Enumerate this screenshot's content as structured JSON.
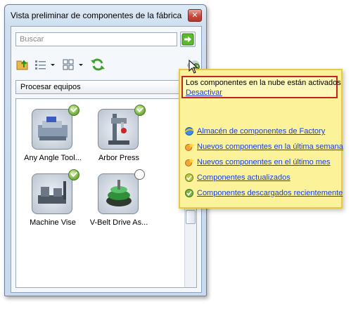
{
  "window": {
    "title": "Vista preliminar de componentes de la fábrica",
    "close_glyph": "✕"
  },
  "search": {
    "placeholder": "Buscar",
    "go_icon": "green-arrow-icon"
  },
  "toolbar": {
    "icons": [
      "folder-upload-icon",
      "list-view-icon",
      "columns-view-icon",
      "refresh-icon",
      "cloud-icon"
    ]
  },
  "dropdown": {
    "selected": "Procesar equipos",
    "caret": "▼"
  },
  "components": [
    {
      "label": "Any Angle Tool...",
      "status": "installed"
    },
    {
      "label": "Arbor Press",
      "status": "installed"
    },
    {
      "label": "Machine Vise",
      "status": "installed"
    },
    {
      "label": "V-Belt Drive As...",
      "status": "not-installed"
    }
  ],
  "popup": {
    "status_text": "Los componentes en la nube están activados",
    "deactivate_label": "Desactivar",
    "links": [
      {
        "label": "Almacén de componentes de Factory",
        "icon": "ie-globe-icon"
      },
      {
        "label": "Nuevos componentes en la última semana",
        "icon": "star-new-icon"
      },
      {
        "label": "Nuevos componentes en el último mes",
        "icon": "star-new-icon"
      },
      {
        "label": "Componentes actualizados",
        "icon": "updated-check-icon"
      },
      {
        "label": "Componentes descargados recientemente",
        "icon": "downloaded-check-icon"
      }
    ]
  },
  "colors": {
    "popup_bg": "#fbf29a",
    "popup_border": "#e6c84a",
    "status_border": "#c8231f",
    "link": "#1a3fd6",
    "check_green": "#7cb342"
  }
}
